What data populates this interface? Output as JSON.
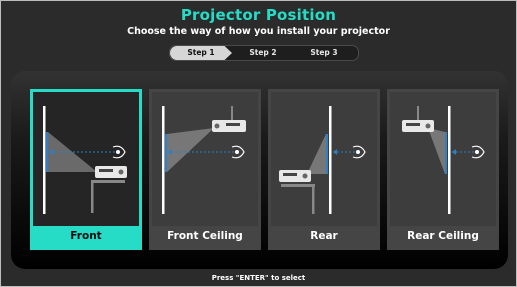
{
  "title": "Projector Position",
  "subtitle": "Choose the way  of how you install your projector",
  "steps": [
    {
      "label": "Step 1",
      "active": true
    },
    {
      "label": "Step 2",
      "active": false
    },
    {
      "label": "Step 3",
      "active": false
    }
  ],
  "options": [
    {
      "label": "Front",
      "selected": true
    },
    {
      "label": "Front Ceiling",
      "selected": false
    },
    {
      "label": "Rear",
      "selected": false
    },
    {
      "label": "Rear Ceiling",
      "selected": false
    }
  ],
  "footer": "Press \"ENTER\" to select",
  "colors": {
    "accent": "#27dcc6",
    "screen_glow": "#2f7fc4"
  }
}
